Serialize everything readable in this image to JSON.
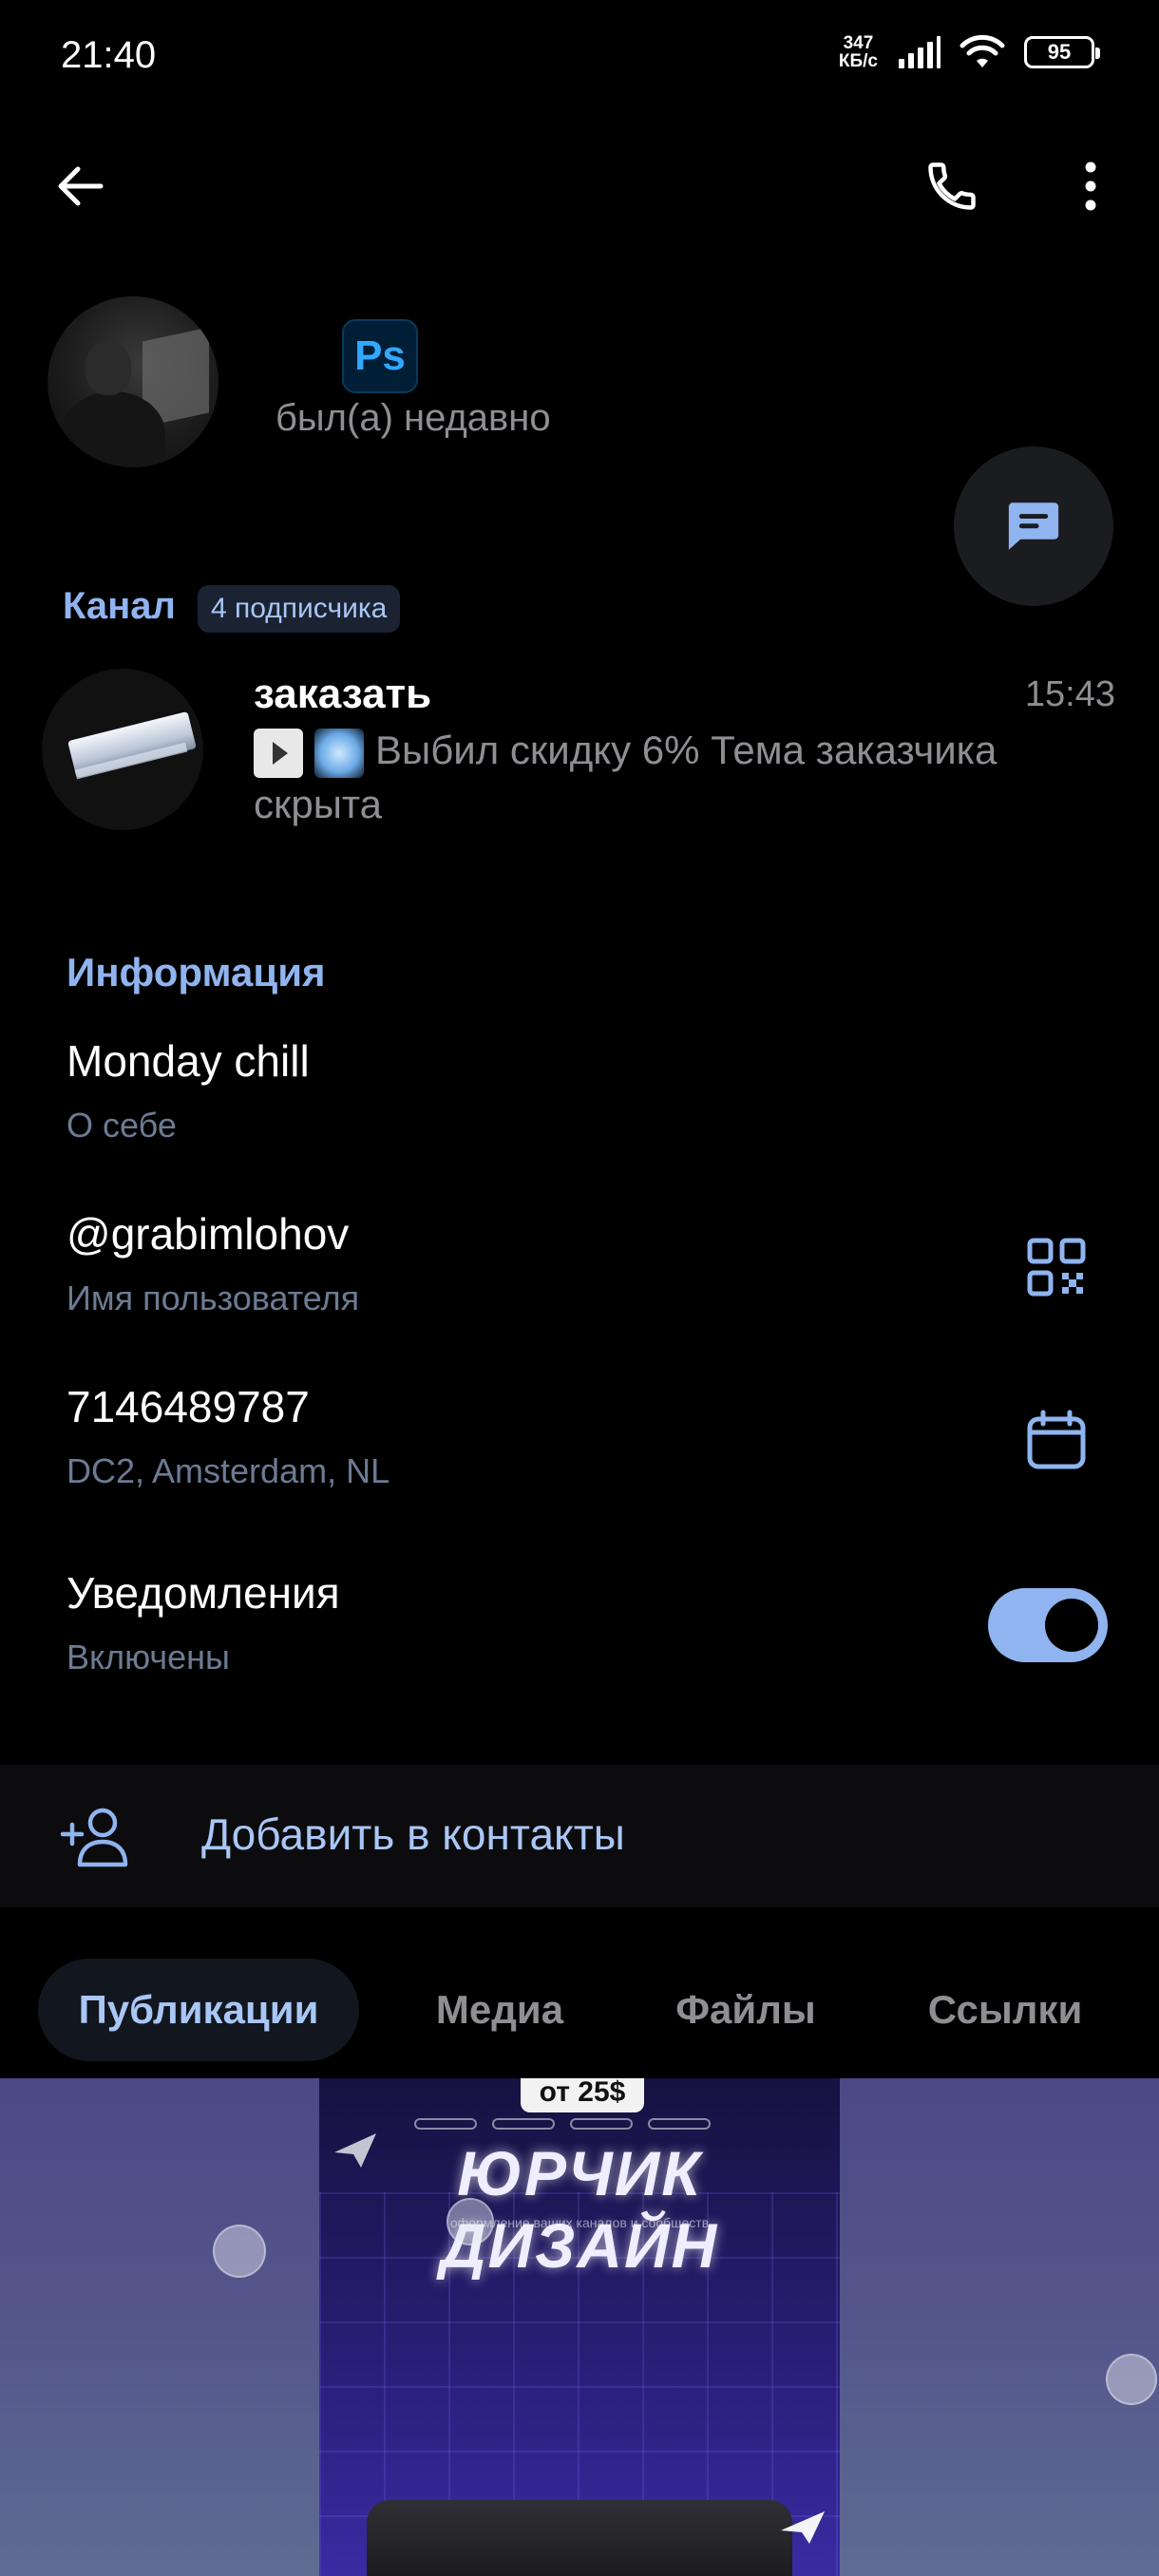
{
  "status_bar": {
    "time": "21:40",
    "net_speed_value": "347",
    "net_speed_unit": "КБ/с",
    "battery": "95",
    "icons": [
      "signal-icon",
      "wifi-icon",
      "battery-icon"
    ]
  },
  "top_bar": {
    "back_icon": "arrow-left-icon",
    "call_icon": "phone-icon",
    "more_icon": "more-vertical-icon"
  },
  "profile": {
    "badge_text": "Ps",
    "last_seen": "был(а) недавно"
  },
  "channel": {
    "title": "Канал",
    "subscribers": "4 подписчика",
    "name": "заказать",
    "time": "15:43",
    "preview": "Выбил скидку 6%  Тема заказчика скрыта"
  },
  "info": {
    "title": "Информация",
    "bio": {
      "value": "Monday chill",
      "label": "О себе"
    },
    "username": {
      "value": "@grabimlohov",
      "label": "Имя пользователя"
    },
    "phone": {
      "value": "7146489787",
      "label": "DC2, Amsterdam, NL"
    },
    "notifications": {
      "value": "Уведомления",
      "label": "Включены",
      "enabled": true
    }
  },
  "add_contact": {
    "label": "Добавить в контакты"
  },
  "tabs": [
    {
      "label": "Публикации",
      "active": true
    },
    {
      "label": "Медиа",
      "active": false
    },
    {
      "label": "Файлы",
      "active": false
    },
    {
      "label": "Ссылки",
      "active": false
    }
  ],
  "post": {
    "price": "от 25$",
    "brand": "ЮРЧИК ДИЗАЙН",
    "tagline": "оформление ваших каналов и сообществ"
  },
  "colors": {
    "accent": "#8fb4ef",
    "background": "#000000",
    "secondary_text": "#8e8e93",
    "label_text": "#6c7b93"
  }
}
